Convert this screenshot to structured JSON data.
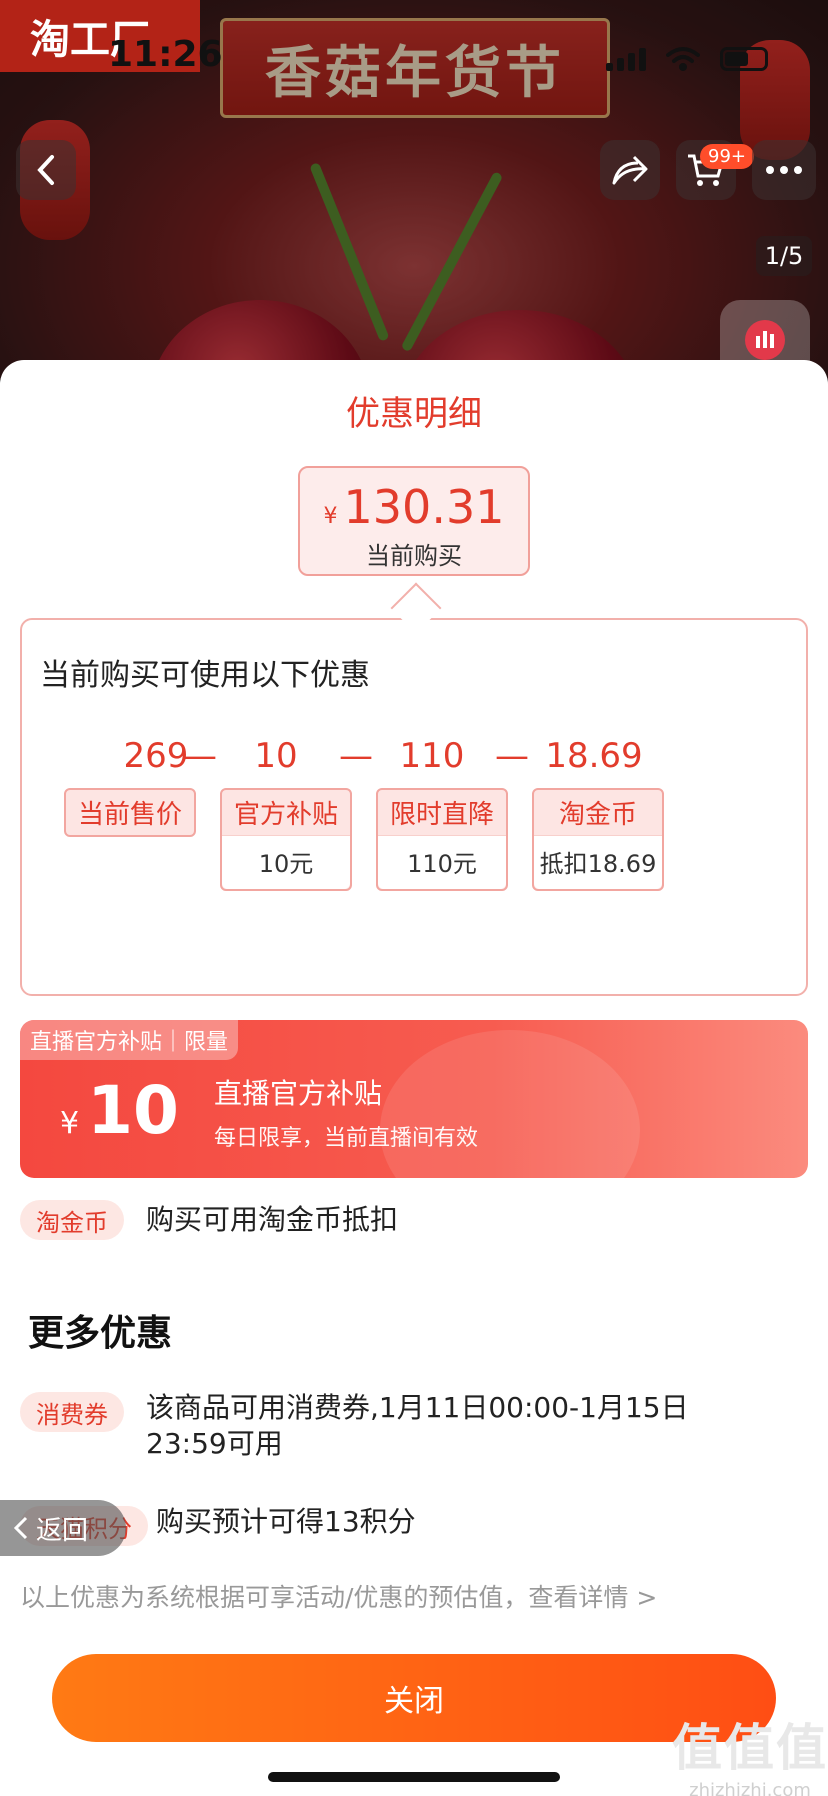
{
  "header": {
    "shop_tag": "淘工厂",
    "status_time": "11:26",
    "banner_title": "香菇年货节",
    "cart_badge": "99+",
    "image_counter": "1/5"
  },
  "sheet": {
    "title": "优惠明细",
    "current_price": {
      "currency": "¥",
      "value": "130.31",
      "label": "当前购买"
    },
    "panel_heading": "当前购买可使用以下优惠",
    "calc": {
      "operator": "—",
      "items": [
        {
          "value": "269",
          "label": "当前售价",
          "sub": ""
        },
        {
          "value": "10",
          "label": "官方补贴",
          "sub": "10元"
        },
        {
          "value": "110",
          "label": "限时直降",
          "sub": "110元"
        },
        {
          "value": "18.69",
          "label": "淘金币",
          "sub": "抵扣18.69"
        }
      ]
    },
    "live_subsidy": {
      "tag": "直播官方补贴｜限量",
      "currency": "¥",
      "amount": "10",
      "title": "直播官方补贴",
      "desc": "每日限享，当前直播间有效"
    },
    "gold_coin": {
      "pill": "淘金币",
      "text": "购买可用淘金币抵扣"
    },
    "more_heading": "更多优惠",
    "voucher": {
      "pill": "消费券",
      "text_line1": "该商品可用消费券,1月11日00:00-1月15日",
      "text_line2": "23:59可用"
    },
    "points": {
      "pill": "天猫积分",
      "text": "购买预计可得13积分"
    },
    "back_float": "返回",
    "footnote": "以上优惠为系统根据可享活动/优惠的预估值，查看详情 >",
    "close_button": "关闭"
  },
  "watermark": {
    "big": "值值值",
    "small": "zhizhizhi.com"
  },
  "colors": {
    "accent": "#e23c2c",
    "button_start": "#ff7a14",
    "button_end": "#ff4e14"
  }
}
